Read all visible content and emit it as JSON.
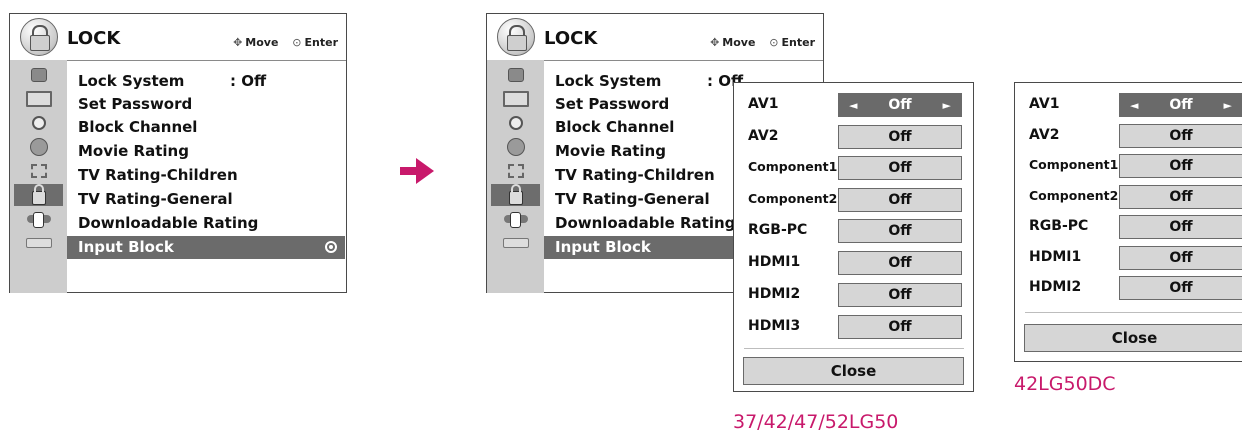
{
  "menu": {
    "title": "LOCK",
    "help": {
      "move": "Move",
      "enter": "Enter"
    },
    "items": [
      {
        "label": "Lock System",
        "value": ": Off"
      },
      {
        "label": "Set Password",
        "value": ""
      },
      {
        "label": "Block Channel",
        "value": ""
      },
      {
        "label": "Movie Rating",
        "value": ""
      },
      {
        "label": "TV Rating-Children",
        "value": ""
      },
      {
        "label": "TV Rating-General",
        "value": ""
      },
      {
        "label": "Downloadable Rating",
        "value": ""
      },
      {
        "label": "Input Block",
        "value": ""
      }
    ],
    "right_lock_value": ": Off",
    "selected_item": "Input Block",
    "side_icons": [
      "camera-icon",
      "screen-icon",
      "disc-icon",
      "clock-icon",
      "film-icon",
      "lock-icon",
      "plug-icon",
      "usb-icon"
    ]
  },
  "input_block_popup": {
    "inputs": [
      {
        "label": "AV1",
        "value": "Off"
      },
      {
        "label": "AV2",
        "value": "Off"
      },
      {
        "label": "Component1",
        "value": "Off"
      },
      {
        "label": "Component2",
        "value": "Off"
      },
      {
        "label": "RGB-PC",
        "value": "Off"
      },
      {
        "label": "HDMI1",
        "value": "Off"
      },
      {
        "label": "HDMI2",
        "value": "Off"
      },
      {
        "label": "HDMI3",
        "value": "Off"
      }
    ],
    "close_label": "Close",
    "model_label": "37/42/47/52LG50"
  },
  "input_block_popup_alt": {
    "inputs": [
      {
        "label": "AV1",
        "value": "Off"
      },
      {
        "label": "AV2",
        "value": "Off"
      },
      {
        "label": "Component1",
        "value": "Off"
      },
      {
        "label": "Component2",
        "value": "Off"
      },
      {
        "label": "RGB-PC",
        "value": "Off"
      },
      {
        "label": "HDMI1",
        "value": "Off"
      },
      {
        "label": "HDMI2",
        "value": "Off"
      }
    ],
    "close_label": "Close",
    "model_label": "42LG50DC"
  },
  "colors": {
    "accent": "#c8196b",
    "selection": "#6b6b6b",
    "sidebar": "#cdcdcd"
  }
}
